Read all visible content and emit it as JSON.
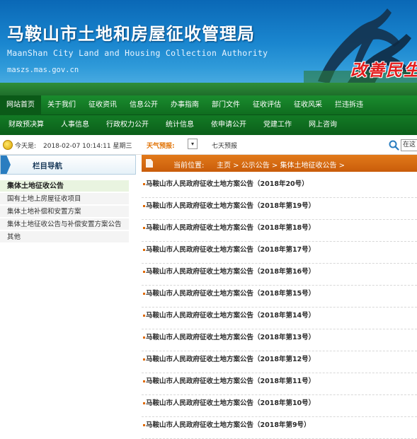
{
  "header": {
    "title": "马鞍山市土地和房屋征收管理局",
    "subtitle": "MaanShan City Land and Housing Collection Authority",
    "domain": "maszs.mas.gov.cn",
    "slogan": "改善民生"
  },
  "nav_primary": [
    "网站首页",
    "关于我们",
    "征收资讯",
    "信息公开",
    "办事指南",
    "部门文件",
    "征收评估",
    "征收风采",
    "拦违拆违"
  ],
  "nav_secondary": [
    "财政预决算",
    "人事信息",
    "行政权力公开",
    "统计信息",
    "依申请公开",
    "党建工作",
    "网上咨询"
  ],
  "infobar": {
    "date_label": "今天是:",
    "date_value": "2018-02-07 10:14:11 星期三",
    "weather_label": "天气预报:",
    "weather_select": "▾",
    "seven_day": "七天预报",
    "search_value": "在这"
  },
  "sidebar": {
    "title": "栏目导航",
    "items": [
      "集体土地征收公告",
      "国有土地上房屋征收项目",
      "集体土地补偿和安置方案",
      "集体土地征收公告与补偿安置方案公告",
      "其他"
    ]
  },
  "breadcrumb": {
    "label": "当前位置:",
    "path": "主页 > 公示公告 > 集体土地征收公告 >"
  },
  "notices": [
    "马鞍山市人民政府征收土地方案公告（2018年20号）",
    "马鞍山市人民政府征收土地方案公告（2018年第19号）",
    "马鞍山市人民政府征收土地方案公告（2018年第18号）",
    "马鞍山市人民政府征收土地方案公告（2018年第17号）",
    "马鞍山市人民政府征收土地方案公告（2018年第16号）",
    "马鞍山市人民政府征收土地方案公告（2018年第15号）",
    "马鞍山市人民政府征收土地方案公告（2018年第14号）",
    "马鞍山市人民政府征收土地方案公告（2018年第13号）",
    "马鞍山市人民政府征收土地方案公告（2018年第12号）",
    "马鞍山市人民政府征收土地方案公告（2018年第11号）",
    "马鞍山市人民政府征收土地方案公告（2018年第10号）",
    "马鞍山市人民政府征收土地方案公告（2018年第9号）"
  ],
  "colors": {
    "nav_green": "#0f6d1f",
    "crumb_orange": "#d06410",
    "banner_blue": "#1a86cf",
    "slogan_red": "#e21d1d"
  }
}
